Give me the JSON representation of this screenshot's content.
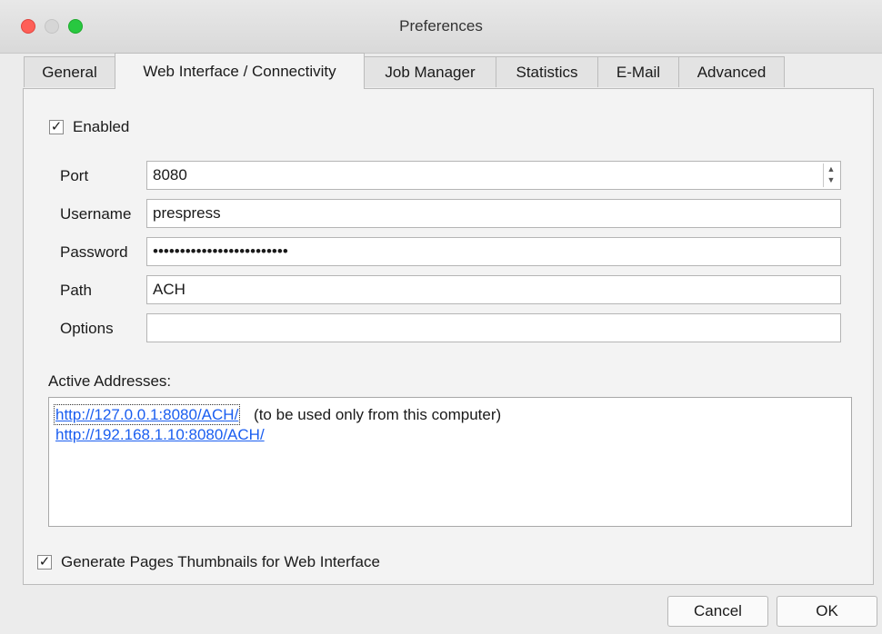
{
  "window": {
    "title": "Preferences"
  },
  "tabs": [
    {
      "label": "General"
    },
    {
      "label": "Web Interface / Connectivity"
    },
    {
      "label": "Job Manager"
    },
    {
      "label": "Statistics"
    },
    {
      "label": "E-Mail"
    },
    {
      "label": "Advanced"
    }
  ],
  "active_tab": "Web Interface / Connectivity",
  "enabled": {
    "label": "Enabled",
    "checked": true,
    "mark": "✓"
  },
  "form": {
    "port": {
      "label": "Port",
      "value": "8080"
    },
    "username": {
      "label": "Username",
      "value": "prespress"
    },
    "password": {
      "label": "Password",
      "value": "•••••••••••••••••••••••••"
    },
    "path": {
      "label": "Path",
      "value": "ACH"
    },
    "options": {
      "label": "Options",
      "value": ""
    }
  },
  "addresses": {
    "label": "Active Addresses:",
    "items": [
      {
        "url": "http://127.0.0.1:8080/ACH/",
        "note": "(to be used only from this computer)"
      },
      {
        "url": "http://192.168.1.10:8080/ACH/",
        "note": ""
      }
    ]
  },
  "thumbnails": {
    "label": "Generate Pages Thumbnails for Web Interface",
    "checked": true,
    "mark": "✓"
  },
  "buttons": {
    "cancel": "Cancel",
    "ok": "OK"
  },
  "colors": {
    "link": "#1a5ef0",
    "close": "#fe5f57",
    "maximize": "#28c840"
  }
}
